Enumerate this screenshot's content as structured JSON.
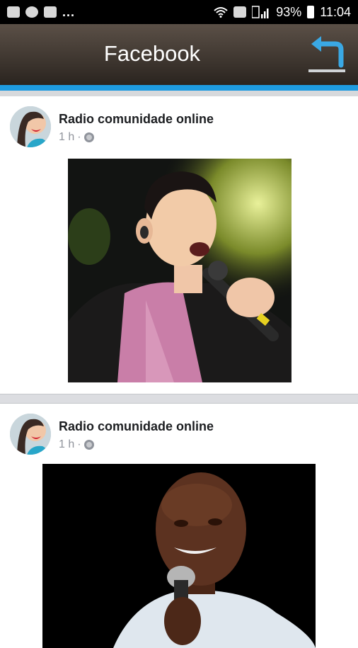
{
  "status_bar": {
    "battery": "93%",
    "time": "11:04",
    "overflow": "..."
  },
  "app_bar": {
    "title": "Facebook"
  },
  "posts": [
    {
      "author": "Radio comunidade online",
      "time": "1 h",
      "separator": "·",
      "privacy_icon": "globe-icon",
      "image_alt": "singer with microphone in pink striped shirt"
    },
    {
      "author": "Radio comunidade online",
      "time": "1 h",
      "separator": "·",
      "privacy_icon": "globe-icon",
      "image_alt": "singer with microphone in white shirt"
    }
  ],
  "colors": {
    "accent": "#1e9be0",
    "app_bar_top": "#5b5047",
    "app_bar_bottom": "#2a241f",
    "meta_text": "#90949c"
  }
}
